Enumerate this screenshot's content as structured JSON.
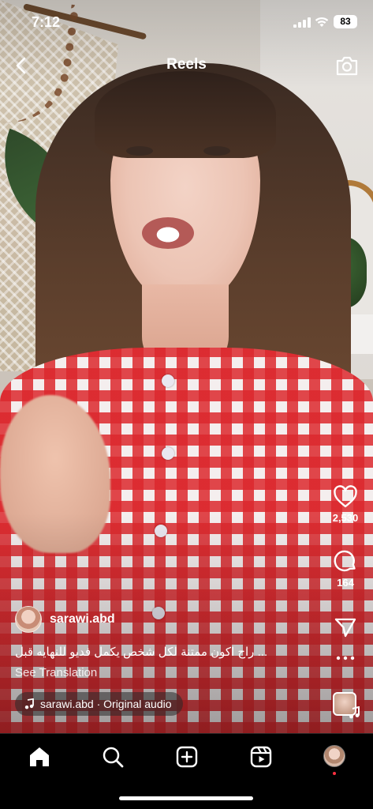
{
  "status_bar": {
    "time": "7:12",
    "battery": "83"
  },
  "header": {
    "title": "Reels"
  },
  "actions": {
    "likes": "2,530",
    "comments": "164"
  },
  "post": {
    "username": "sarawi.abd",
    "caption": "راح اكون ممتنة لكل شخص يكمل فديو للنهايه قبل ...",
    "see_translation": "See Translation",
    "audio": "sarawi.abd · Original audio"
  },
  "tabs": [
    "home",
    "search",
    "create",
    "reels",
    "profile"
  ],
  "icons": {
    "back": "chevron-left-icon",
    "camera": "camera-icon",
    "like": "heart-icon",
    "comment": "comment-bubble-icon",
    "share": "paper-plane-icon",
    "more": "ellipsis-icon",
    "audio": "music-note-icon"
  },
  "colors": {
    "notification_dot": "#ff3040",
    "background": "#000000"
  }
}
